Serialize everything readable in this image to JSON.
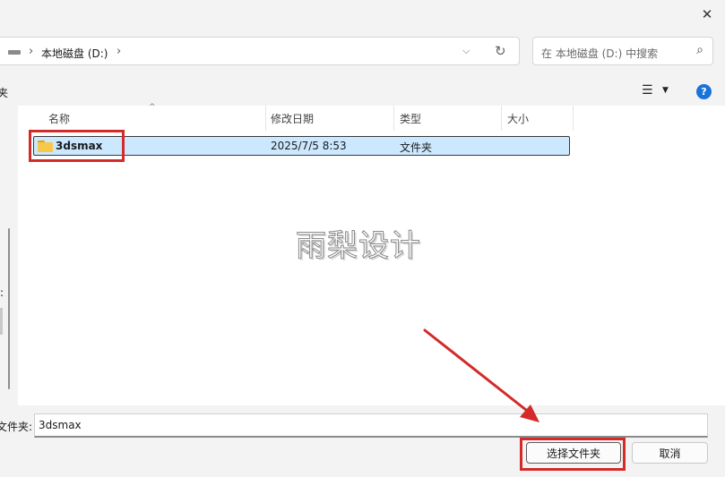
{
  "window": {
    "close_glyph": "✕"
  },
  "address_bar": {
    "path_text": "本地磁盘 (D:)",
    "chevron": "›"
  },
  "search": {
    "placeholder": "在 本地磁盘 (D:) 中搜索"
  },
  "toolbar": {
    "left_fragment": "夹"
  },
  "left_pane": {
    "fragment": ":"
  },
  "file_list": {
    "columns": {
      "name": "名称",
      "modified": "修改日期",
      "type": "类型",
      "size": "大小"
    },
    "rows": [
      {
        "name": "3dsmax",
        "modified": "2025/7/5 8:53",
        "type": "文件夹",
        "size": ""
      }
    ]
  },
  "watermark": "雨梨设计",
  "footer": {
    "folder_label": "文件夹:",
    "folder_value": "3dsmax",
    "select_button": "选择文件夹",
    "cancel_button": "取消"
  },
  "colors": {
    "annotation_red": "#d32a2a",
    "selection_bg": "#cce8ff",
    "accent": "#1a73d9"
  }
}
